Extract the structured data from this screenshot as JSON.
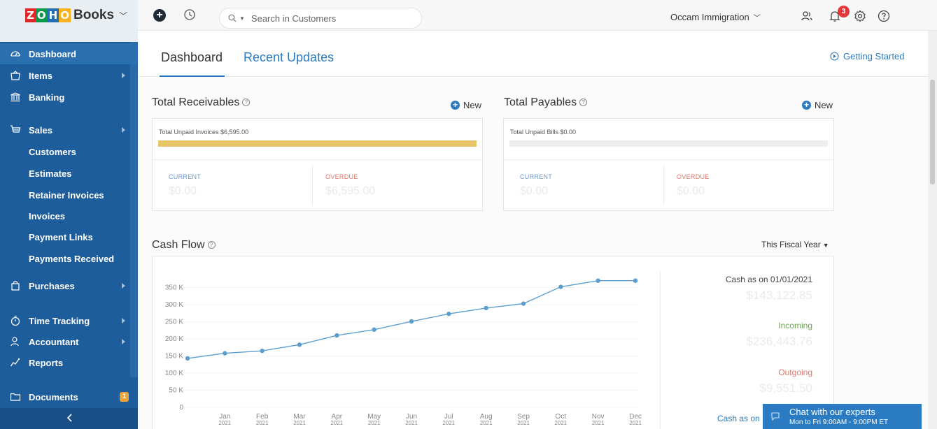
{
  "header": {
    "brand_logo_text": "ZOHO",
    "brand_name": "Books",
    "search_placeholder": "Search in Customers",
    "org_name": "Occam Immigration",
    "notification_count": "3"
  },
  "sidebar": {
    "items": [
      {
        "label": "Dashboard",
        "icon": "dashboard-icon"
      },
      {
        "label": "Items",
        "icon": "items-icon"
      },
      {
        "label": "Banking",
        "icon": "bank-icon"
      },
      {
        "label": "Sales",
        "icon": "cart-icon"
      },
      {
        "label": "Purchases",
        "icon": "bag-icon"
      },
      {
        "label": "Time Tracking",
        "icon": "stopwatch-icon"
      },
      {
        "label": "Accountant",
        "icon": "accountant-icon"
      },
      {
        "label": "Reports",
        "icon": "reports-icon"
      },
      {
        "label": "Documents",
        "icon": "folder-icon"
      }
    ],
    "sales_sub": [
      "Customers",
      "Estimates",
      "Retainer Invoices",
      "Invoices",
      "Payment Links",
      "Payments Received"
    ],
    "documents_count": "1"
  },
  "tabs": {
    "dashboard": "Dashboard",
    "recent": "Recent Updates",
    "getting_started": "Getting Started"
  },
  "receivables": {
    "title": "Total Receivables",
    "new_label": "New",
    "caption": "Total Unpaid Invoices $6,595.00",
    "fill_fraction": 1.0,
    "current_label": "CURRENT",
    "current_value": "$0.00",
    "overdue_label": "OVERDUE",
    "overdue_value": "$6,595.00"
  },
  "payables": {
    "title": "Total Payables",
    "new_label": "New",
    "caption": "Total Unpaid Bills $0.00",
    "fill_fraction": 0.0,
    "current_label": "CURRENT",
    "current_value": "$0.00",
    "overdue_label": "OVERDUE",
    "overdue_value": "$0.00"
  },
  "cashflow": {
    "title": "Cash Flow",
    "period": "This Fiscal Year",
    "cash_start_label": "Cash as on 01/01/2021",
    "cash_start_value": "$143,122.85",
    "incoming_label": "Incoming",
    "incoming_value": "$236,443.76",
    "outgoing_label": "Outgoing",
    "outgoing_value": "$9,551.50",
    "cash_end_label": "Cash as on"
  },
  "chart_data": {
    "type": "line",
    "categories": [
      "",
      "Jan 2021",
      "Feb 2021",
      "Mar 2021",
      "Apr 2021",
      "May 2021",
      "Jun 2021",
      "Jul 2021",
      "Aug 2021",
      "Sep 2021",
      "Oct 2021",
      "Nov 2021",
      "Dec 2021"
    ],
    "x_ticks": [
      {
        "m": "Jan",
        "y": "2021"
      },
      {
        "m": "Feb",
        "y": "2021"
      },
      {
        "m": "Mar",
        "y": "2021"
      },
      {
        "m": "Apr",
        "y": "2021"
      },
      {
        "m": "May",
        "y": "2021"
      },
      {
        "m": "Jun",
        "y": "2021"
      },
      {
        "m": "Jul",
        "y": "2021"
      },
      {
        "m": "Aug",
        "y": "2021"
      },
      {
        "m": "Sep",
        "y": "2021"
      },
      {
        "m": "Oct",
        "y": "2021"
      },
      {
        "m": "Nov",
        "y": "2021"
      },
      {
        "m": "Dec",
        "y": "2021"
      }
    ],
    "series": [
      {
        "values": [
          143000,
          158000,
          165000,
          183000,
          210000,
          227000,
          251000,
          273000,
          290000,
          303000,
          352000,
          370000,
          370000
        ]
      }
    ],
    "y_ticks": [
      "0",
      "50 K",
      "100 K",
      "150 K",
      "200 K",
      "250 K",
      "300 K",
      "350 K"
    ],
    "ylim": [
      0,
      350000
    ],
    "color": "#5b9fd0"
  },
  "chat": {
    "title": "Chat with our experts",
    "hours": "Mon to Fri 9:00AM - 9:00PM ET"
  }
}
